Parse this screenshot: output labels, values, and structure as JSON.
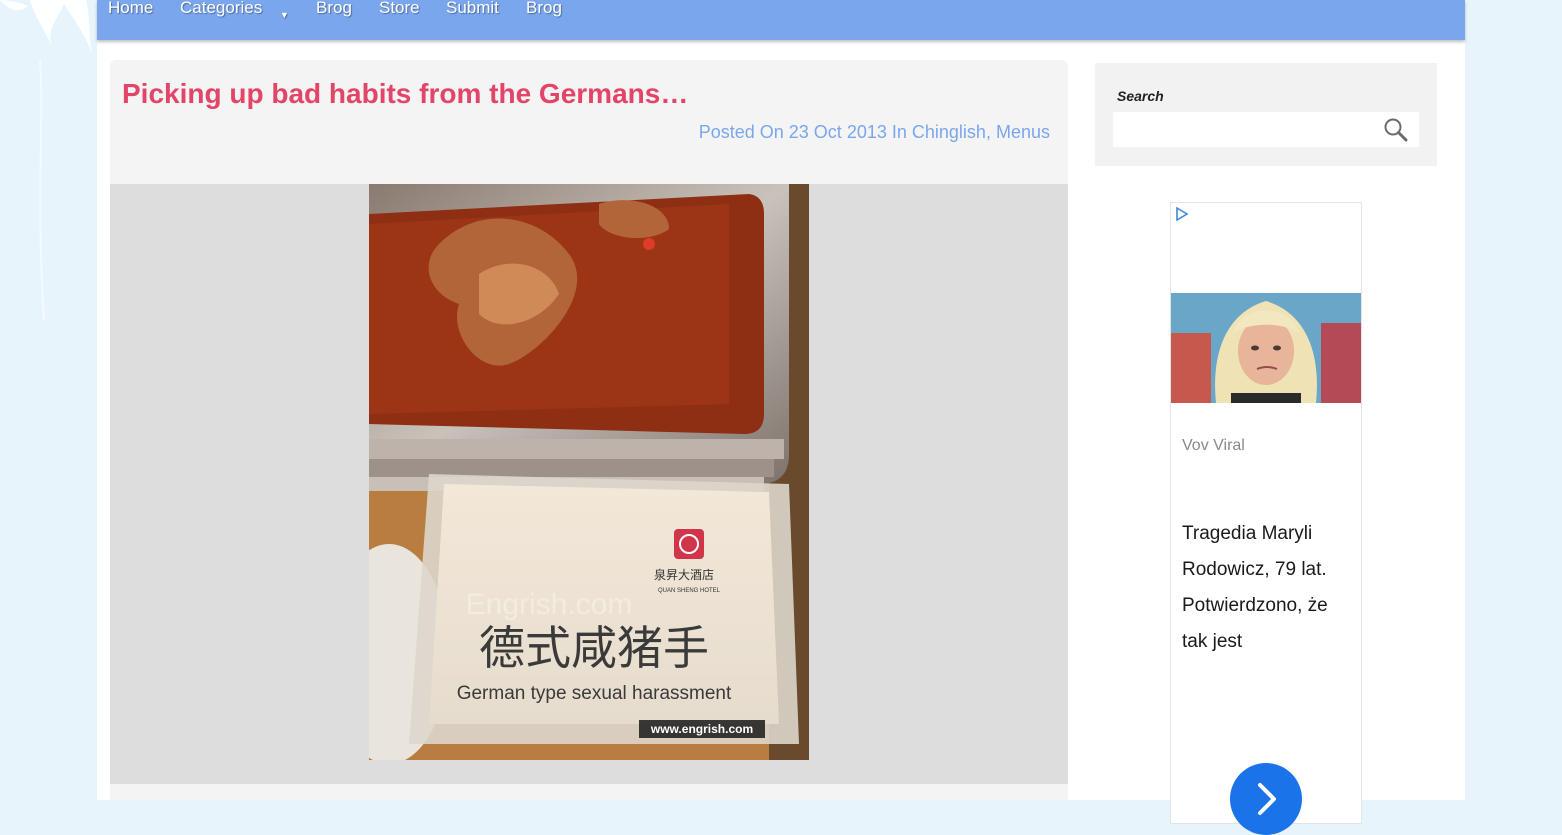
{
  "nav": {
    "items": [
      {
        "label": "Home"
      },
      {
        "label": "Categories"
      },
      {
        "label": "Brog"
      },
      {
        "label": "Store"
      },
      {
        "label": "Submit"
      },
      {
        "label": "Brog"
      }
    ],
    "dropdown_icon": "caret-down-icon"
  },
  "post": {
    "title": "Picking up bad habits from the Germans…",
    "meta_prefix": "Posted On 23 Oct 2013 In",
    "categories": [
      "Chinglish",
      "Menus"
    ],
    "separator": ",",
    "image": {
      "sign_hotel_cn": "泉昇大酒店",
      "sign_hotel_en": "QUAN SHENG HOTEL",
      "sign_dish_cn": "德式咸猪手",
      "sign_dish_en": "German type sexual harassment",
      "watermark": "Engrish.com",
      "source_url": "www.engrish.com"
    }
  },
  "sidebar": {
    "search_label": "Search",
    "search_placeholder": "",
    "search_icon": "magnifier-icon"
  },
  "ad": {
    "choices_icon": "ad-choices-icon",
    "source": "Vov Viral",
    "headline": "Tragedia Maryli Rodowicz, 79 lat. Potwierdzono, że tak jest",
    "button_icon": "chevron-right-icon",
    "button_color": "#1a73e8"
  },
  "colors": {
    "nav_bg": "#7aa6ee",
    "title": "#e24567",
    "meta": "#7aa6ee",
    "body_bg": "#e8f4fb"
  }
}
